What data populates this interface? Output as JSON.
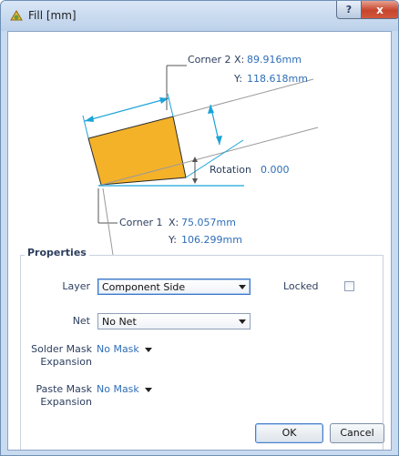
{
  "window": {
    "title": "Fill [mm]",
    "help_icon": "question-mark-glyph",
    "close_icon": "x-glyph",
    "help_text": "?",
    "close_text": "x"
  },
  "diagram": {
    "corner2_label": "Corner 2",
    "corner2_x_prefix": "X:",
    "corner2_x": "89.916mm",
    "corner2_y_prefix": "Y:",
    "corner2_y": "118.618mm",
    "rotation_label": "Rotation",
    "rotation_value": "0.000",
    "corner1_label": "Corner 1",
    "corner1_x_prefix": "X:",
    "corner1_x": "75.057mm",
    "corner1_y_prefix": "Y:",
    "corner1_y": "106.299mm",
    "fill_color": "#f4b229",
    "dimension_color": "#1aa3d9"
  },
  "properties": {
    "title": "Properties",
    "layer_label": "Layer",
    "layer_value": "Component Side",
    "locked_label": "Locked",
    "locked_checked": false,
    "net_label": "Net",
    "net_value": "No Net",
    "solder_mask_label_line1": "Solder Mask",
    "solder_mask_label_line2": "Expansion",
    "solder_mask_value": "No Mask",
    "paste_mask_label_line1": "Paste Mask",
    "paste_mask_label_line2": "Expansion",
    "paste_mask_value": "No Mask"
  },
  "buttons": {
    "ok": "OK",
    "cancel": "Cancel"
  }
}
